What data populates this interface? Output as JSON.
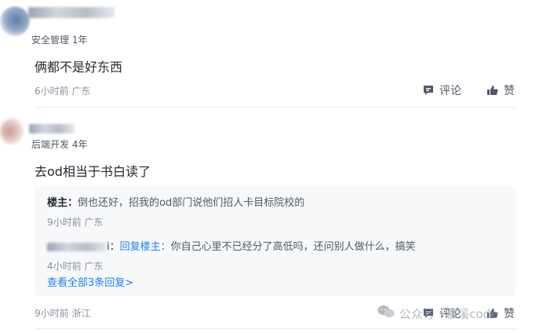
{
  "comments": [
    {
      "author_masked": "",
      "subtitle": "安全管理 1年",
      "text": "俩都不是好东西",
      "time": "6小时前 广东",
      "comment_label": "评论",
      "like_label": "赞"
    },
    {
      "author_masked": "",
      "subtitle": "后端开发 4年",
      "text": "去od相当于书白读了",
      "time": "9小时前 浙江",
      "comment_label": "评论",
      "like_label": "赞",
      "replies": [
        {
          "author": "楼主：",
          "text": "倒也还好，招我的od部门说他们招人卡目标院校的",
          "time": "9小时前 广东"
        },
        {
          "author_suffix": "i：",
          "reply_link": "回复楼主：",
          "text": "你自己心里不已经分了高低吗，还问别人做什么，搞笑",
          "time": "4小时前 广东"
        }
      ],
      "view_all": "查看全部3条回复>"
    }
  ],
  "watermark": "公众号 · 慕溪code",
  "colors": {
    "link": "#1e80ff",
    "muted": "#8a919f",
    "text": "#252933",
    "reply_bg": "#f7f8fa"
  }
}
